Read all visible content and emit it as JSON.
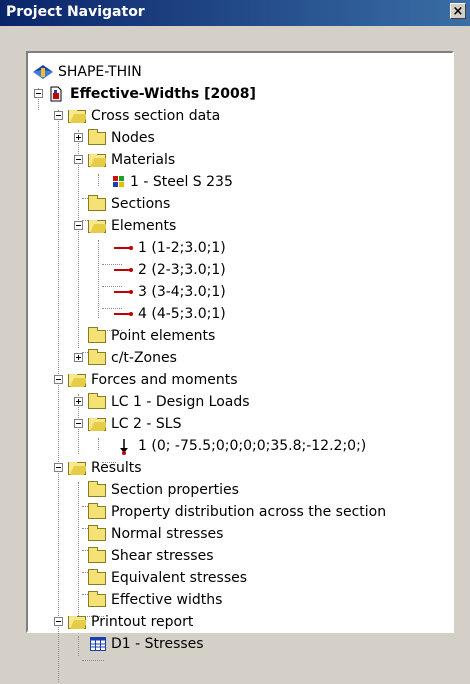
{
  "window": {
    "title": "Project Navigator",
    "close_label": "×"
  },
  "tree": {
    "root": "SHAPE-THIN",
    "project": "Effective-Widths [2008]",
    "cross_section": {
      "label": "Cross section data",
      "nodes": "Nodes",
      "materials": "Materials",
      "material_1": "1 - Steel S 235",
      "sections": "Sections",
      "elements": "Elements",
      "element_items": [
        "1 (1-2;3.0;1)",
        "2 (2-3;3.0;1)",
        "3 (3-4;3.0;1)",
        "4 (4-5;3.0;1)"
      ],
      "point_elements": "Point elements",
      "ct_zones": "c/t-Zones"
    },
    "forces": {
      "label": "Forces and moments",
      "lc1": "LC 1 - Design Loads",
      "lc2": "LC 2 - SLS",
      "lc2_item": "1 (0; -75.5;0;0;0;0;35.8;-12.2;0;)"
    },
    "results": {
      "label": "Results",
      "items": [
        "Section properties",
        "Property distribution across the section",
        "Normal stresses",
        "Shear stresses",
        "Equivalent stresses",
        "Effective widths"
      ]
    },
    "printout": {
      "label": "Printout report",
      "item": "D1 - Stresses"
    }
  },
  "colors": {
    "titlebar": "#0a246a",
    "folder": "#f4e275",
    "member_red": "#c00000"
  },
  "icons": {
    "root": "shape-thin-logo-icon",
    "project": "project-file-icon",
    "material": "material-colors-icon",
    "element": "member-line-icon",
    "load": "force-arrow-icon",
    "report": "report-table-icon"
  }
}
